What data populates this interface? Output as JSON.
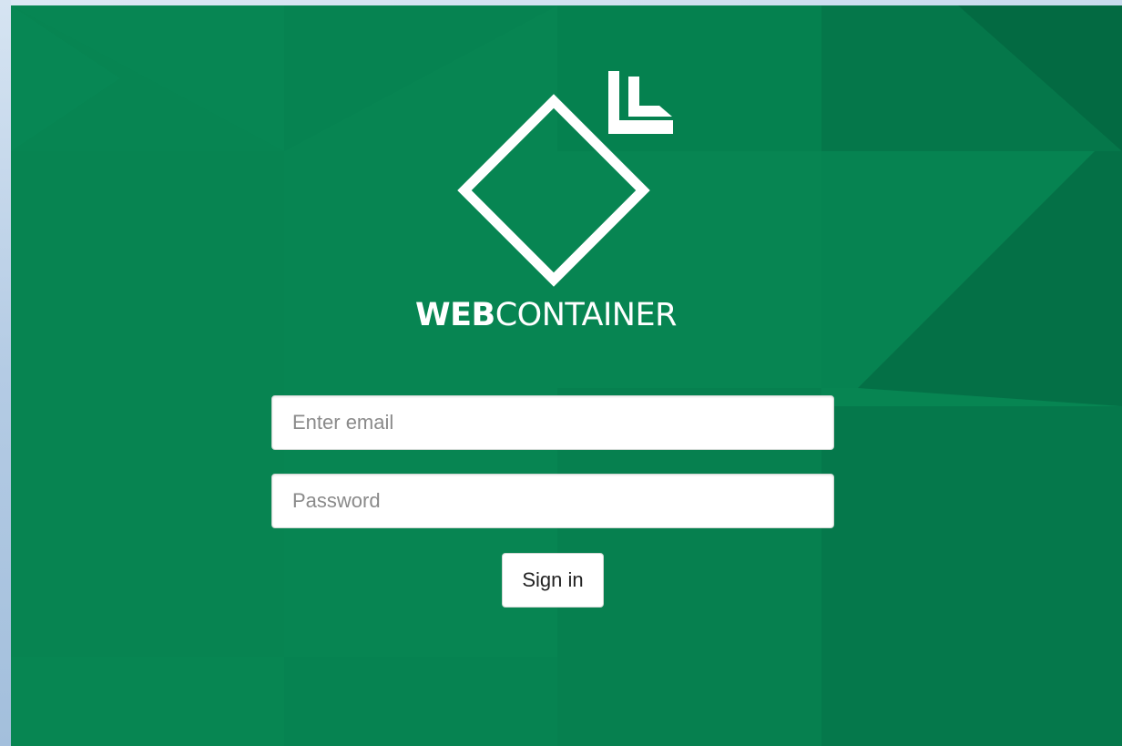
{
  "brand": {
    "bold": "WEB",
    "light": "CONTAINER",
    "logo_icon": "webcontainer-logo-icon",
    "color": "#ffffff"
  },
  "form": {
    "email": {
      "value": "",
      "placeholder": "Enter email"
    },
    "password": {
      "value": "",
      "placeholder": "Password"
    },
    "submit_label": "Sign in"
  },
  "colors": {
    "background": "#078552",
    "background_dark": "#046440",
    "field_background": "#ffffff"
  }
}
